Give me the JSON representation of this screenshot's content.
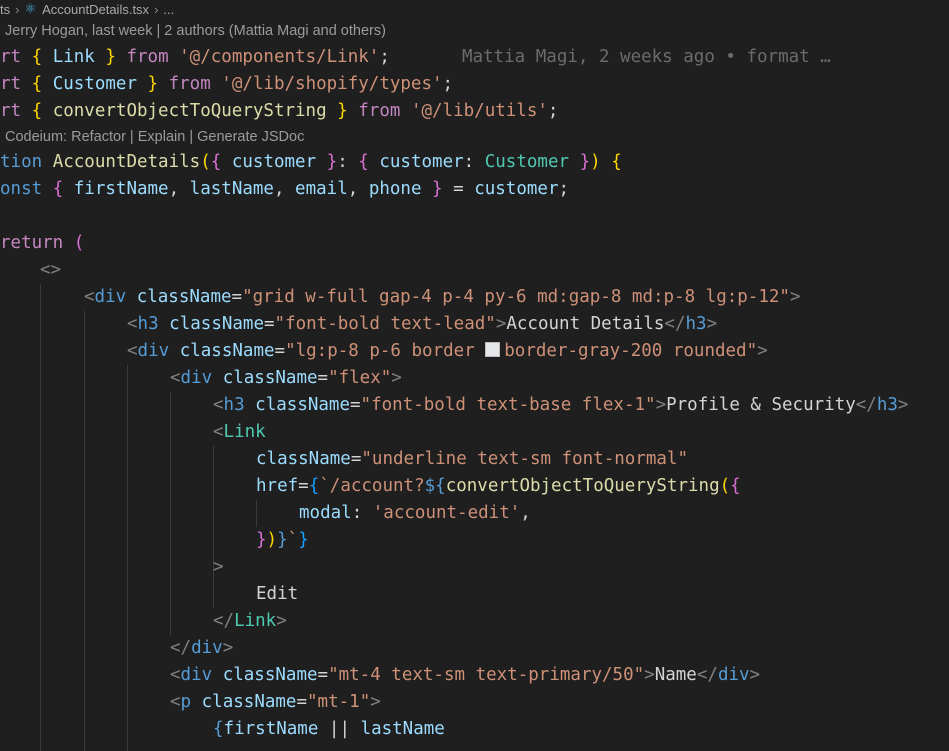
{
  "breadcrumb": {
    "prefix": "ts",
    "file": "AccountDetails.tsx",
    "tail": "..."
  },
  "authors_lens": "Jerry Hogan, last week | 2 authors (Mattia Magi and others)",
  "codeium_lens": {
    "prefix": "Codeium: ",
    "refactor": "Refactor",
    "explain": "Explain",
    "generate": "Generate JSDoc",
    "sep": " | "
  },
  "blame": "Mattia Magi, 2 weeks ago • format …",
  "lines": {
    "l1": [
      "rt ",
      "{",
      " Link ",
      "}",
      " from ",
      "'@/components/Link'",
      ";"
    ],
    "l2": [
      "rt ",
      "{",
      " Customer ",
      "}",
      " from ",
      "'@/lib/shopify/types'",
      ";"
    ],
    "l3": [
      "rt ",
      "{",
      " convertObjectToQueryString ",
      "}",
      " from ",
      "'@/lib/utils'",
      ";"
    ],
    "l4": [
      "tion ",
      "AccountDetails",
      "(",
      "{",
      " customer ",
      "}",
      ": ",
      "{",
      " customer",
      ": ",
      "Customer",
      " ",
      "}",
      ")",
      " ",
      "{"
    ],
    "l5": [
      "onst ",
      "{",
      " firstName",
      ", ",
      "lastName",
      ", ",
      "email",
      ", ",
      "phone",
      " ",
      "}",
      " = ",
      "customer",
      ";"
    ],
    "l6": [
      "return ",
      "("
    ],
    "l7": [
      "<>"
    ],
    "l8": [
      "<",
      "div",
      " ",
      "className",
      "=",
      "\"grid w-full gap-4 p-4 py-6 md:gap-8 md:p-8 lg:p-12\"",
      ">"
    ],
    "l9": [
      "<",
      "h3",
      " ",
      "className",
      "=",
      "\"font-bold text-lead\"",
      ">",
      "Account Details",
      "</",
      "h3",
      ">"
    ],
    "l10": [
      "<",
      "div",
      " ",
      "className",
      "=",
      "\"lg:p-8 p-6 border ",
      "border-gray-200 rounded\"",
      ">"
    ],
    "l11": [
      "<",
      "div",
      " ",
      "className",
      "=",
      "\"flex\"",
      ">"
    ],
    "l12": [
      "<",
      "h3",
      " ",
      "className",
      "=",
      "\"font-bold text-base flex-1\"",
      ">",
      "Profile & Security",
      "</",
      "h3",
      ">"
    ],
    "l13": [
      "<",
      "Link"
    ],
    "l14": [
      "className",
      "=",
      "\"underline text-sm font-normal\""
    ],
    "l15": [
      "href",
      "=",
      "{",
      "`/account?",
      "${",
      "convertObjectToQueryString",
      "(",
      "{"
    ],
    "l16": [
      "modal",
      ": ",
      "'account-edit'",
      ","
    ],
    "l17": [
      "}",
      ")",
      "}",
      "`",
      "}"
    ],
    "l18": [
      ">"
    ],
    "l19": [
      "Edit"
    ],
    "l20": [
      "</",
      "Link",
      ">"
    ],
    "l21": [
      "</",
      "div",
      ">"
    ],
    "l22": [
      "<",
      "div",
      " ",
      "className",
      "=",
      "\"mt-4 text-sm text-primary/50\"",
      ">",
      "Name",
      "</",
      "div",
      ">"
    ],
    "l23": [
      "<",
      "p",
      " ",
      "className",
      "=",
      "\"mt-1\"",
      ">"
    ],
    "l24": [
      "{",
      "firstName",
      " || ",
      "lastName"
    ]
  },
  "colors": {
    "background": "#1f1f1f",
    "keyword": "#c586c0",
    "tag": "#569cd6",
    "attribute": "#9cdcfe",
    "string": "#ce9178",
    "function": "#dcdcaa",
    "type": "#4ec9b0",
    "bracket_gold": "#ffd700",
    "bracket_pink": "#da70d6",
    "bracket_blue": "#179fff",
    "color_swatch": "#e5e7eb"
  },
  "icons": {
    "file_icon": "react-icon",
    "breadcrumb_separator": "chevron-right-icon"
  }
}
